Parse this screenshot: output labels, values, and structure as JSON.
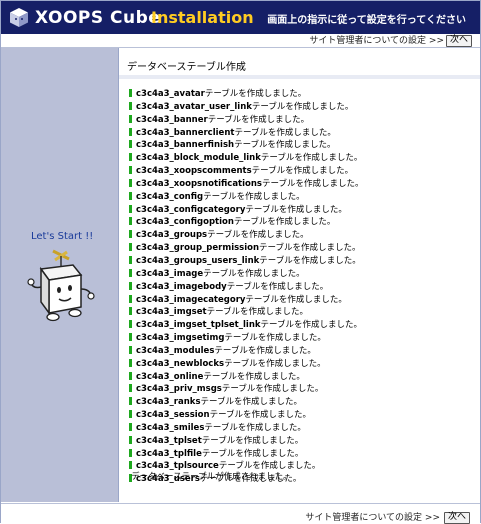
{
  "header": {
    "brand": "XOOPS Cube",
    "subtitle": "Installation",
    "hint": "画面上の指示に従って設定を行ってください",
    "logo_icon": "cube-logo-icon",
    "colors": {
      "bar": "#151f66",
      "accent": "#ffcc22"
    }
  },
  "nav": {
    "next_step_text": "サイト管理者についての設定 >>",
    "next_button": "次へ"
  },
  "sidebar": {
    "lets_start": "Let's Start !!",
    "mascot_icon": "cube-mascot-icon"
  },
  "main": {
    "title": "データベーステーブル作成",
    "table_suffix": "テーブルを作成しました。",
    "tables": [
      "c3c4a3_avatar",
      "c3c4a3_avatar_user_link",
      "c3c4a3_banner",
      "c3c4a3_bannerclient",
      "c3c4a3_bannerfinish",
      "c3c4a3_block_module_link",
      "c3c4a3_xoopscomments",
      "c3c4a3_xoopsnotifications",
      "c3c4a3_config",
      "c3c4a3_configcategory",
      "c3c4a3_configoption",
      "c3c4a3_groups",
      "c3c4a3_group_permission",
      "c3c4a3_groups_users_link",
      "c3c4a3_image",
      "c3c4a3_imagebody",
      "c3c4a3_imagecategory",
      "c3c4a3_imgset",
      "c3c4a3_imgset_tplset_link",
      "c3c4a3_imgsetimg",
      "c3c4a3_modules",
      "c3c4a3_newblocks",
      "c3c4a3_online",
      "c3c4a3_priv_msgs",
      "c3c4a3_ranks",
      "c3c4a3_session",
      "c3c4a3_smiles",
      "c3c4a3_tplset",
      "c3c4a3_tplfile",
      "c3c4a3_tplsource",
      "c3c4a3_users"
    ],
    "done_message": "データベーステーブルが作成されました。",
    "status_color": "#1ea81e"
  },
  "footer": {
    "next_step_text": "サイト管理者についての設定 >>",
    "next_button": "次へ"
  }
}
